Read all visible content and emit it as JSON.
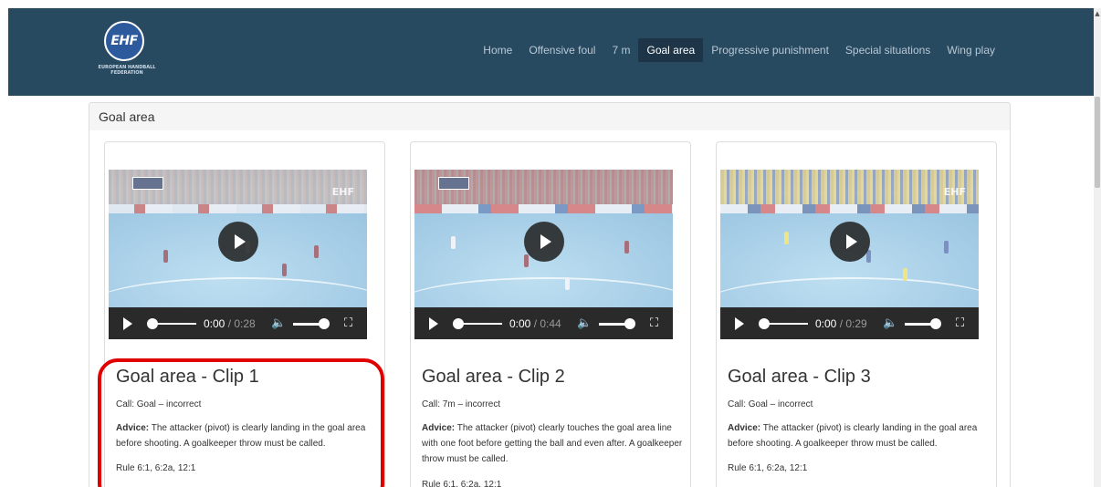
{
  "brand": {
    "logo_text": "EHF",
    "logo_subtitle": "EUROPEAN HANDBALL FEDERATION",
    "colors": {
      "navbar": "#284a61",
      "active_nav": "#1d3547",
      "highlight": "#e00000"
    }
  },
  "nav": {
    "items": [
      {
        "label": "Home"
      },
      {
        "label": "Offensive foul"
      },
      {
        "label": "7 m"
      },
      {
        "label": "Goal area",
        "active": true
      },
      {
        "label": "Progressive punishment"
      },
      {
        "label": "Special situations"
      },
      {
        "label": "Wing play"
      }
    ]
  },
  "panel": {
    "title": "Goal area"
  },
  "cards": [
    {
      "title": "Goal area - Clip 1",
      "call": "Call: Goal – incorrect",
      "advice_label": "Advice:",
      "advice": " The attacker (pivot) is clearly landing in the goal area before shooting. A goalkeeper throw must be called.",
      "rule": "Rule 6:1, 6:2a, 12:1",
      "video": {
        "current": "0:00",
        "duration": "/ 0:28"
      }
    },
    {
      "title": "Goal area - Clip 2",
      "call": "Call: 7m – incorrect",
      "advice_label": "Advice:",
      "advice": " The attacker (pivot) clearly touches the goal area line with one foot before getting the ball and even after. A goalkeeper throw must be called.",
      "rule": "Rule 6:1, 6:2a, 12:1",
      "video": {
        "current": "0:00",
        "duration": "/ 0:44"
      }
    },
    {
      "title": "Goal area - Clip 3",
      "call": "Call: Goal – incorrect",
      "advice_label": "Advice:",
      "advice": " The attacker (pivot) is clearly landing in the goal area before shooting. A goalkeeper throw must be called.",
      "rule": "Rule 6:1, 6:2a, 12:1",
      "video": {
        "current": "0:00",
        "duration": "/ 0:29"
      }
    }
  ],
  "icons": {
    "play": "play-icon",
    "volume": "volume-icon",
    "fullscreen": "fullscreen-icon"
  }
}
